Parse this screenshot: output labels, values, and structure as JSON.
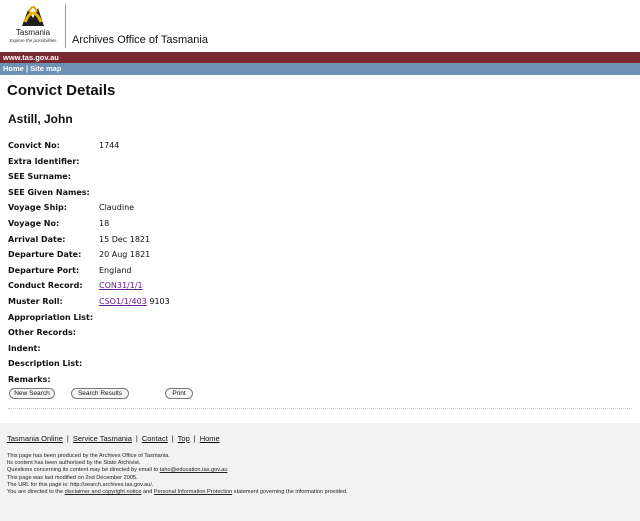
{
  "header": {
    "logo_word": "Tasmania",
    "logo_tagline": "Explore the possibilities",
    "agency": "Archives Office of Tasmania",
    "site_url": "www.tas.gov.au",
    "nav_home": "Home",
    "nav_sep": "|",
    "nav_sitemap": "Site map"
  },
  "page": {
    "title": "Convict Details",
    "person_name": "Astill, John"
  },
  "details": [
    {
      "label": "Convict No:",
      "value": "1744"
    },
    {
      "label": "Extra Identifier:",
      "value": ""
    },
    {
      "label": "SEE Surname:",
      "value": ""
    },
    {
      "label": "SEE Given Names:",
      "value": ""
    },
    {
      "label": "Voyage Ship:",
      "value": "Claudine"
    },
    {
      "label": "Voyage No:",
      "value": "18"
    },
    {
      "label": "Arrival Date:",
      "value": "15 Dec 1821"
    },
    {
      "label": "Departure Date:",
      "value": "20 Aug 1821"
    },
    {
      "label": "Departure Port:",
      "value": "England"
    },
    {
      "label": "Conduct Record:",
      "link": "CON31/1/1"
    },
    {
      "label": "Muster Roll:",
      "link": "CSO1/1/403",
      "extra": " 9103"
    },
    {
      "label": "Appropriation List:",
      "value": ""
    },
    {
      "label": "Other Records:",
      "value": ""
    },
    {
      "label": "Indent:",
      "value": ""
    },
    {
      "label": "Description List:",
      "value": ""
    },
    {
      "label": "Remarks:",
      "value": ""
    }
  ],
  "buttons": {
    "new_search": "New Search",
    "search_results": "Search Results",
    "print": "Print"
  },
  "footer": {
    "links": [
      "Tasmania Online",
      "Service Tasmania",
      "Contact",
      "Top",
      "Home"
    ],
    "sep": "|",
    "line1": "This page has been produced by the Archives Office of Tasmania.",
    "line2": "Its content has been authorised by the State Archivist.",
    "line3_pre": "Questions concerning its content may be directed by email to ",
    "line3_email": "taho@education.tas.gov.au",
    "line4": "This page was last modified on 2nd December 2005.",
    "line5": "The URL for this page is: http://search.archives.tas.gov.au/.",
    "line6_pre": "You are directed to the ",
    "line6_link1": "disclaimer and copyright notice",
    "line6_mid": " and ",
    "line6_link2": "Personal Information Protection",
    "line6_post": " statement governing the information provided."
  },
  "colors": {
    "redbar": "#7a2a2e",
    "bluebar": "#6c91b4",
    "link_visited": "#6a1e8a"
  }
}
